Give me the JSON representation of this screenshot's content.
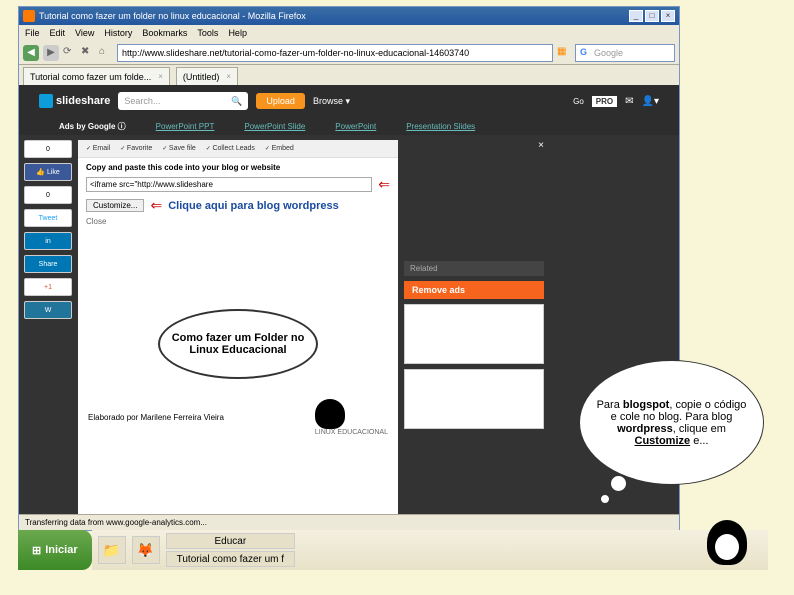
{
  "window": {
    "title": "Tutorial como fazer um folder no linux educacional - Mozilla Firefox",
    "menus": [
      "File",
      "Edit",
      "View",
      "History",
      "Bookmarks",
      "Tools",
      "Help"
    ],
    "url": "http://www.slideshare.net/tutorial-como-fazer-um-folder-no-linux-educacional-14603740",
    "search_engine": "Google",
    "tabs": [
      {
        "label": "Tutorial como fazer um folde..."
      },
      {
        "label": "(Untitled)"
      }
    ],
    "status": "Transferring data from www.google-analytics.com..."
  },
  "slideshare": {
    "logo": "slideshare",
    "search_placeholder": "Search...",
    "upload": "Upload",
    "browse": "Browse ▾",
    "go": "Go",
    "pro": "PRO",
    "ads_label": "Ads by Google ⓘ",
    "ad_links": [
      "PowerPoint PPT",
      "PowerPoint Slide",
      "PowerPoint",
      "Presentation Slides"
    ],
    "panel_actions": [
      "Email",
      "Favorite",
      "Save file",
      "Collect Leads",
      "Embed"
    ],
    "copy_label": "Copy and paste this code into your blog or website",
    "embed_value": "<iframe src=\"http://www.slideshare",
    "customize_btn": "Customize...",
    "close": "Close",
    "annotation": "Clique aqui para blog wordpress",
    "slide_title": "Como fazer um Folder no Linux Educacional",
    "author": "Elaborado por Marilene Ferreira Vieira",
    "le_brand": "LINUX EDUCACIONAL",
    "related": "Related",
    "remove_ads": "Remove ads"
  },
  "social": {
    "buttons": [
      "0",
      "Like",
      "0",
      "Tweet",
      "in",
      "Share",
      "+1",
      "W"
    ]
  },
  "callout": {
    "text_parts": [
      "Para ",
      "blogspot",
      ", copie o código e cole no blog. Para blog ",
      "wordpress",
      ", clique em ",
      "Customize",
      " e..."
    ]
  },
  "taskbar": {
    "start": "Iniciar",
    "items": [
      "Educar",
      "Tutorial como fazer um f"
    ]
  }
}
